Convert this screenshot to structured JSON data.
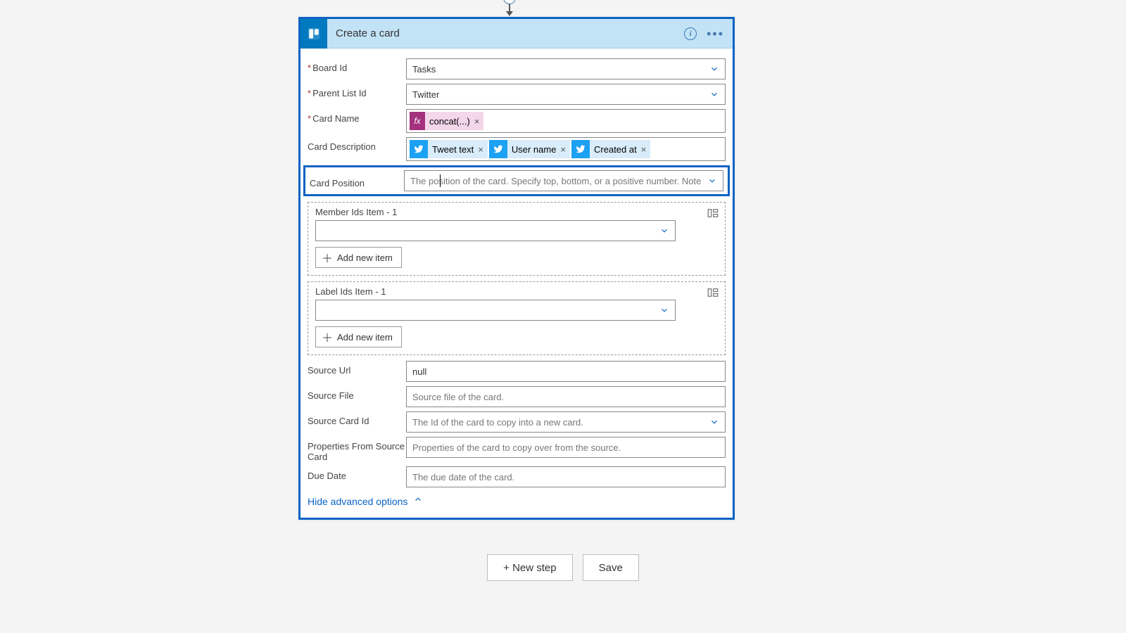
{
  "header": {
    "title": "Create a card"
  },
  "fields": {
    "board_id": {
      "label": "Board Id",
      "value": "Tasks",
      "required": true
    },
    "parent_list": {
      "label": "Parent List Id",
      "value": "Twitter",
      "required": true
    },
    "card_name": {
      "label": "Card Name",
      "required": true,
      "tokens": [
        {
          "kind": "fx",
          "label": "concat(...)"
        }
      ]
    },
    "card_desc": {
      "label": "Card Description",
      "tokens": [
        {
          "kind": "tw",
          "label": "Tweet text"
        },
        {
          "kind": "tw",
          "label": "User name"
        },
        {
          "kind": "tw",
          "label": "Created at"
        }
      ]
    },
    "card_pos": {
      "label": "Card Position",
      "placeholder": "The position of the card. Specify top, bottom, or a positive number. Note"
    },
    "members": {
      "label": "Member Ids Item - 1",
      "add": "Add new item"
    },
    "labels": {
      "label": "Label Ids Item - 1",
      "add": "Add new item"
    },
    "source_url": {
      "label": "Source Url",
      "value": "null"
    },
    "source_file": {
      "label": "Source File",
      "placeholder": "Source file of the card."
    },
    "source_card": {
      "label": "Source Card Id",
      "placeholder": "The Id of the card to copy into a new card."
    },
    "props": {
      "label": "Properties From Source Card",
      "placeholder": "Properties of the card to copy over from the source."
    },
    "due": {
      "label": "Due Date",
      "placeholder": "The due date of the card."
    }
  },
  "link": {
    "label": "Hide advanced options"
  },
  "footer": {
    "new_step": "+ New step",
    "save": "Save"
  }
}
